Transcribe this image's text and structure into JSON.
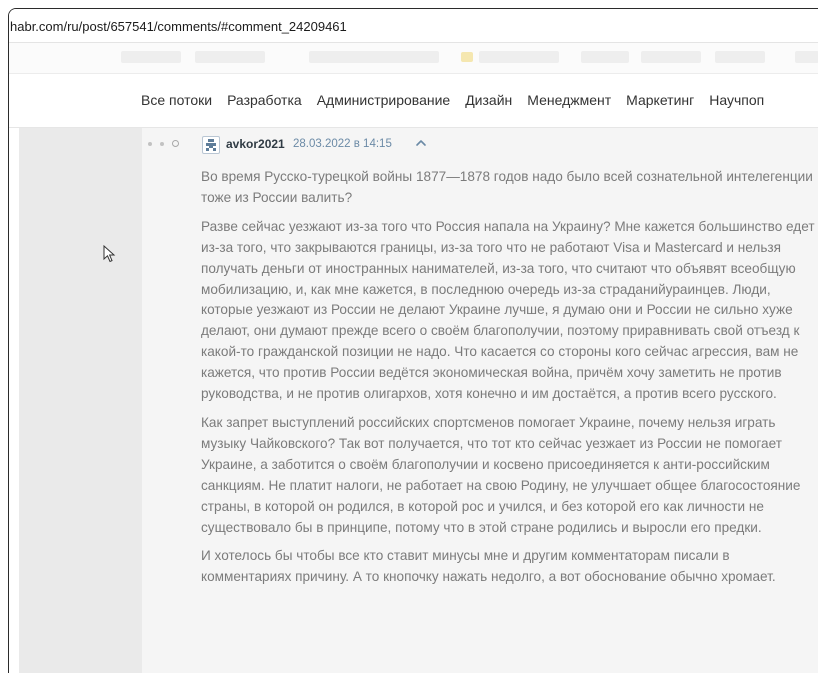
{
  "browser": {
    "url": "habr.com/ru/post/657541/comments/#comment_24209461"
  },
  "nav": {
    "flows": [
      "Все потоки",
      "Разработка",
      "Администрирование",
      "Дизайн",
      "Менеджмент",
      "Маркетинг",
      "Научпоп"
    ]
  },
  "comment": {
    "username": "avkor2021",
    "datetime": "28.03.2022 в 14:15",
    "paragraphs": [
      "Во время Русско-турецкой войны 1877—1878 годов надо было всей сознательной интелегенции тоже из России валить?",
      "Разве сейчас уезжают из-за того что Россия напала на Украину? Мне кажется большинство едет из-за того, что закрываются границы, из-за того что не работают Visa и Mastercard и нельзя получать деньги от иностранных нанимателей, из-за того, что считают что объявят всеобщую мобилизацию, и, как мне кажется, в последнюю очередь из-за страданийураинцев. Люди, которые уезжают из России не делают Украине лучше, я думаю они и России не сильно хуже делают, они думают прежде всего о своём благополучии, поэтому приравнивать свой отъезд к какой-то гражданской позиции не надо. Что касается со стороны кого сейчас агрессия, вам не кажется, что против России ведётся экономическая война, причём хочу заметить не против руководства, и не против олигархов, хотя конечно и им достаётся, а против всего русского.",
      "Как запрет выступлений российских спортсменов помогает Украине, почему нельзя играть музыку Чайковского? Так вот получается, что тот кто сейчас уезжает из России не помогает Украине, а заботится о своём благополучии и косвено присоединяется к анти-российским санкциям. Не платит налоги, не работает на свою Родину, не улучшает общее благосостояние страны, в которой он родился, в которой рос и учился, и без которой его как личности не существовало бы в принципе, потому что в этой стране родились и выросли его предки.",
      "И хотелось бы чтобы все кто ставит минусы мне и другим комментаторам писали в комментариях причину. А то кнопочку нажать недолго, а вот обоснование обычно хромает."
    ]
  },
  "icons": {
    "cursor": "mouse-pointer-icon",
    "avatar": "avatar-identicon",
    "thread": "thread-dots-icon",
    "parent": "arrow-up-icon"
  },
  "colors": {
    "username": "#303b44",
    "datetime": "#6b8aa6",
    "body_text": "#7b7b7b",
    "background": "#eaeaea",
    "comment_bg": "#f5f5f5"
  }
}
